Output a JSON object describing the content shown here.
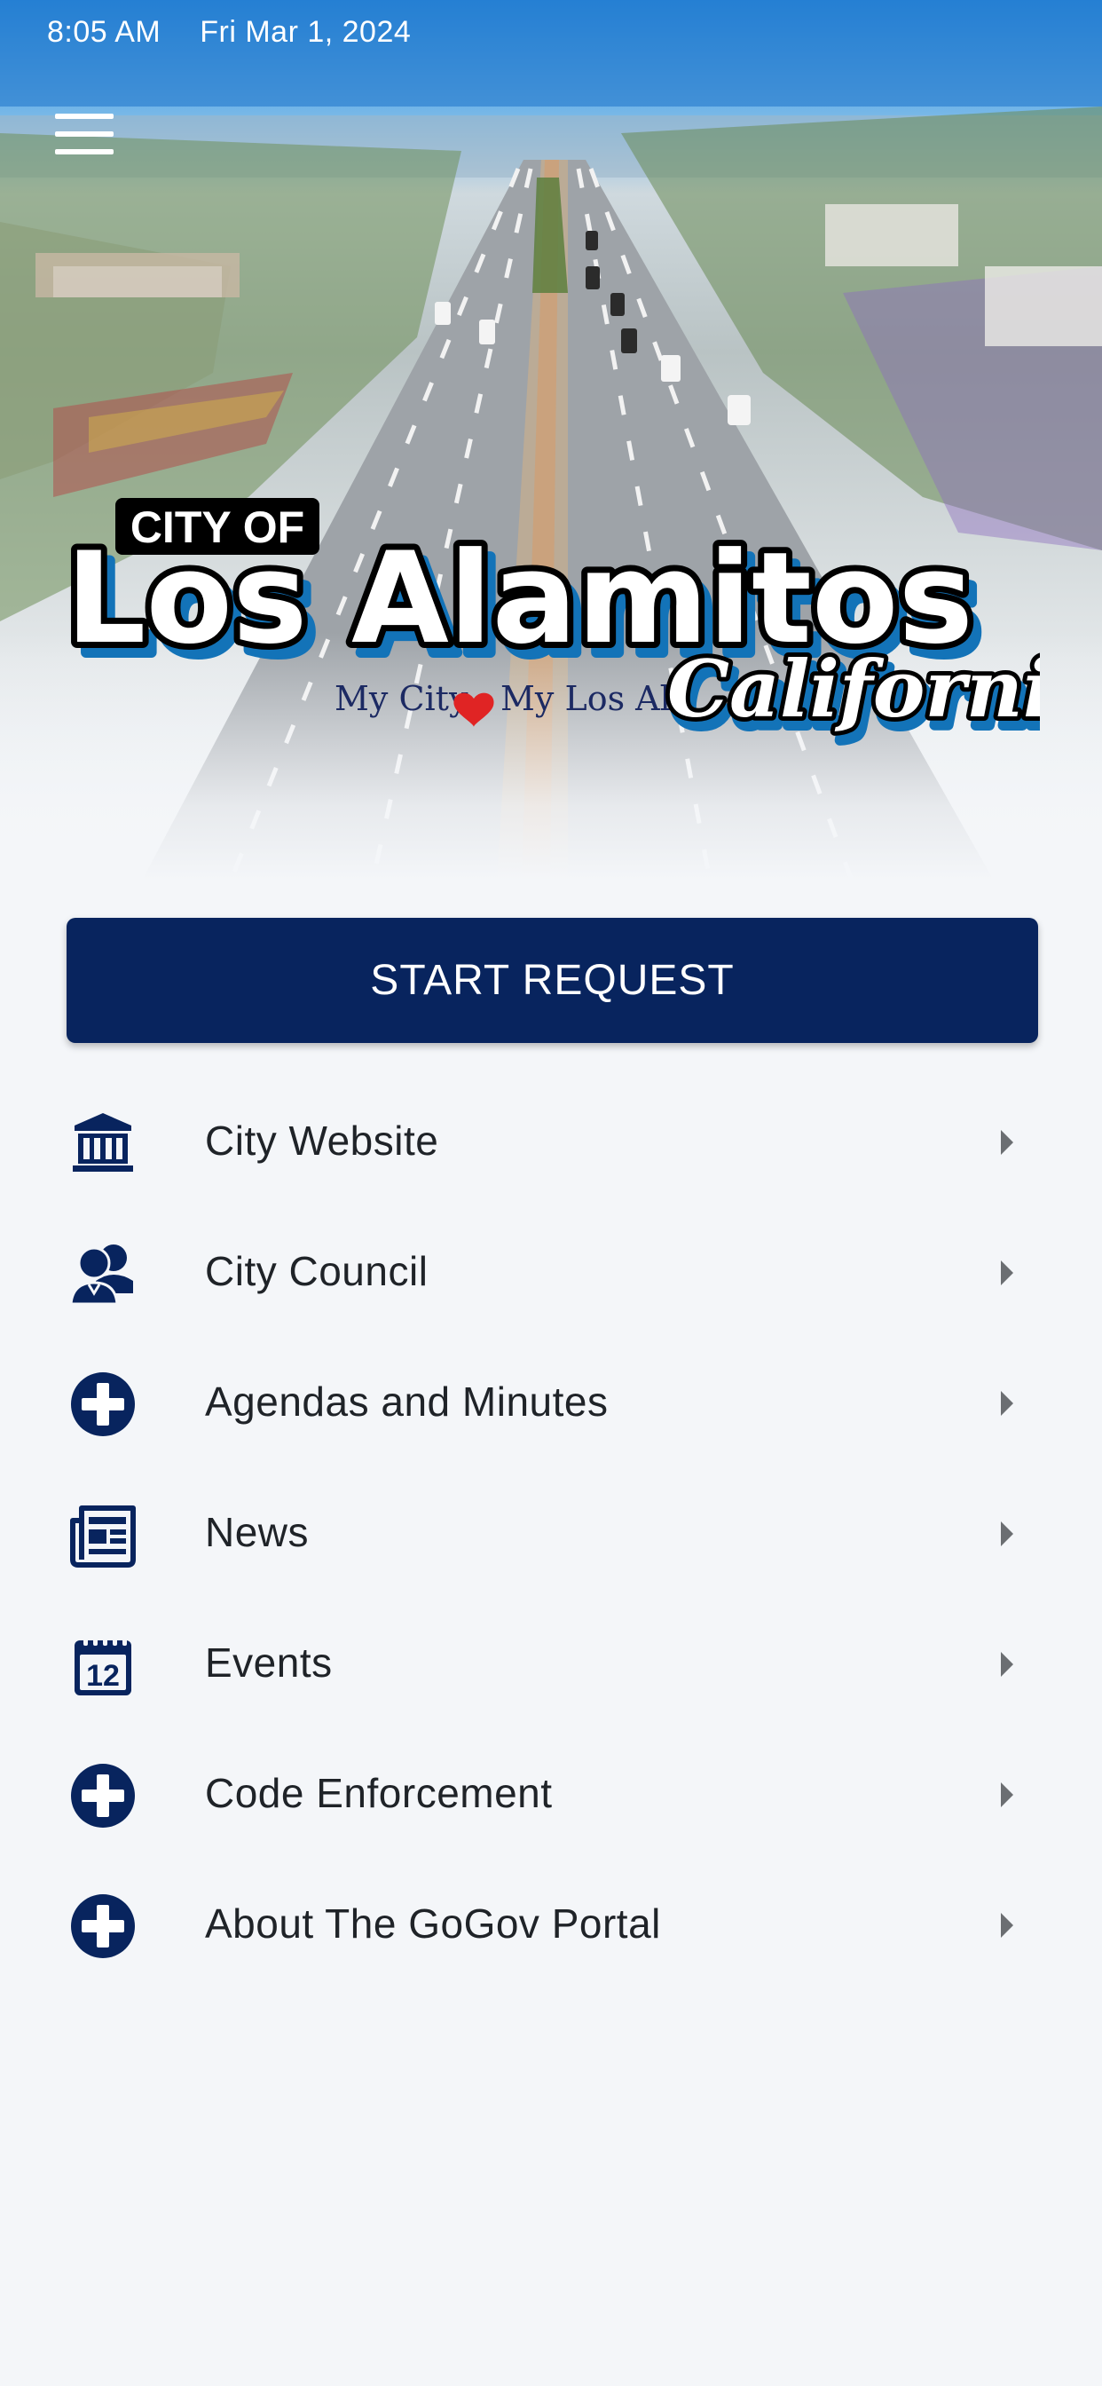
{
  "status_bar": {
    "time": "8:05 AM",
    "date": "Fri Mar 1, 2024"
  },
  "header": {
    "menu_icon": "hamburger-menu-icon"
  },
  "logo": {
    "line1": "CITY OF",
    "line2": "Los Alamitos",
    "tagline_left": "My City",
    "tagline_right": "My Los Al",
    "heart_icon": "heart-icon",
    "script": "California"
  },
  "primary_action": {
    "label": "START REQUEST"
  },
  "menu": {
    "items": [
      {
        "label": "City Website",
        "icon": "city-hall-icon"
      },
      {
        "label": "City Council",
        "icon": "people-icon"
      },
      {
        "label": "Agendas and Minutes",
        "icon": "plus-circle-icon"
      },
      {
        "label": "News",
        "icon": "newspaper-icon"
      },
      {
        "label": "Events",
        "icon": "calendar-icon",
        "icon_text": "12"
      },
      {
        "label": "Code Enforcement",
        "icon": "plus-circle-icon"
      },
      {
        "label": "About The GoGov Portal",
        "icon": "plus-circle-icon"
      }
    ]
  },
  "colors": {
    "primary": "#08245e",
    "background": "#f4f6f9",
    "logo_blue": "#1373b8",
    "heart": "#e02424",
    "chevron": "#6b6e72",
    "text": "#1f2328"
  }
}
